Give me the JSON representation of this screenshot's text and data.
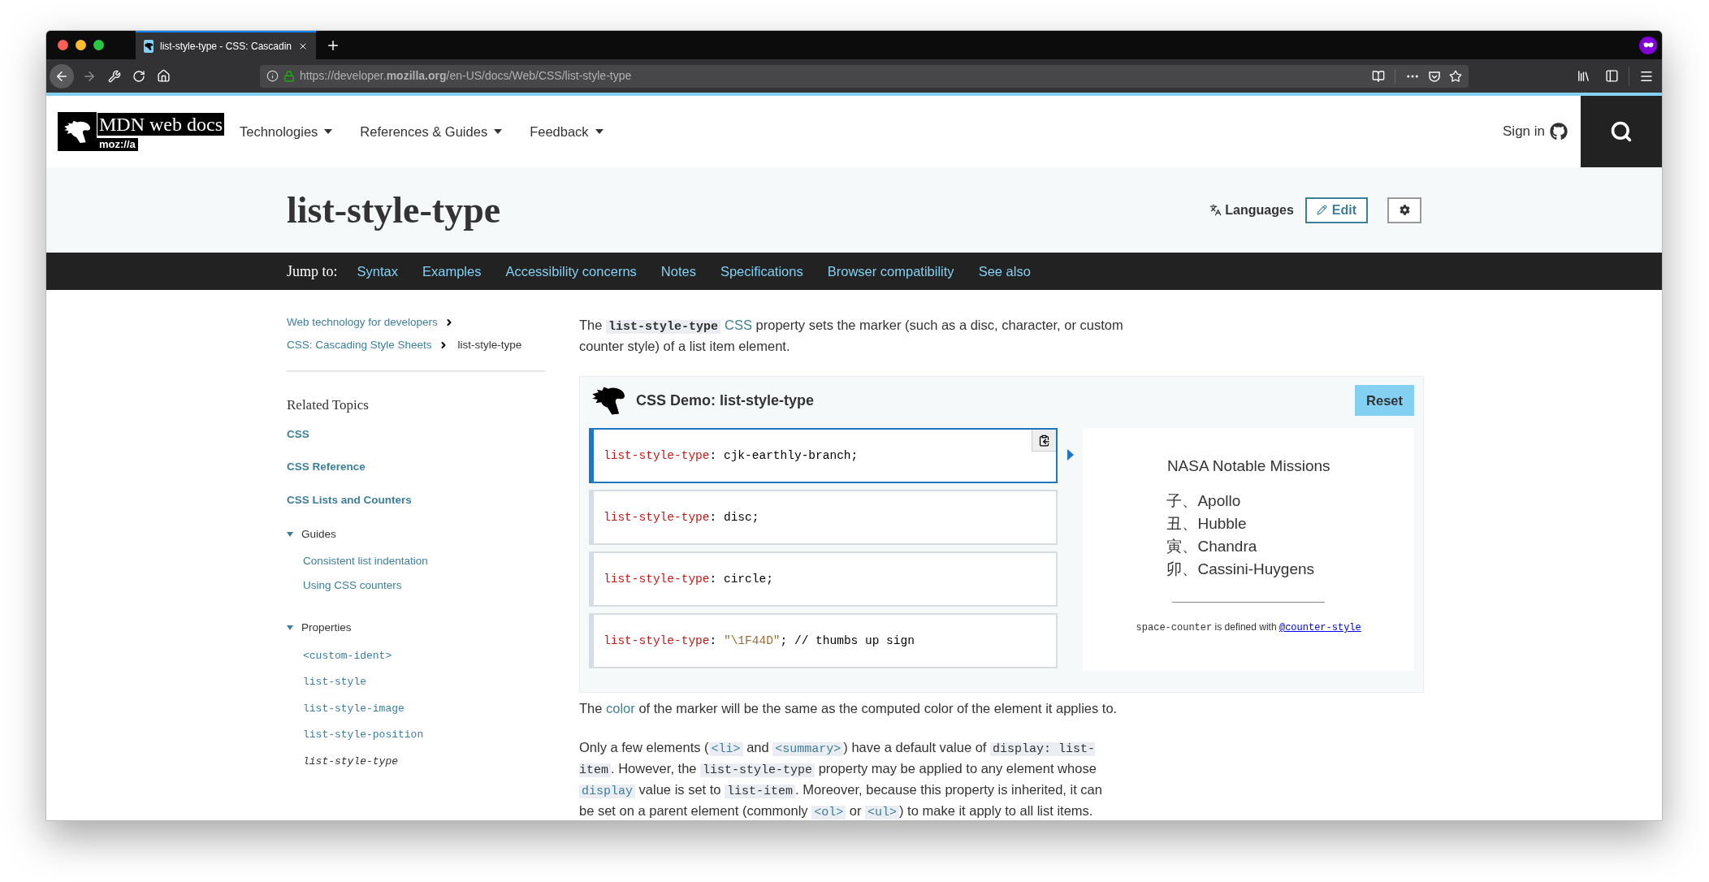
{
  "browser": {
    "tab": {
      "title": "list-style-type - CSS: Cascadin",
      "selected": true
    },
    "url": "https://developer.**mozilla.org**/en-US/docs/Web/CSS/list-style-type"
  },
  "header": {
    "logo_text": "MDN web docs",
    "logo_subtext": "moz://a",
    "nav": [
      {
        "label": "Technologies"
      },
      {
        "label": "References & Guides"
      },
      {
        "label": "Feedback"
      }
    ],
    "sign_in": "Sign in"
  },
  "title": "list-style-type",
  "languages": "Languages",
  "edit": "Edit",
  "jump": {
    "label": "Jump to:",
    "links": [
      "Syntax",
      "Examples",
      "Accessibility concerns",
      "Notes",
      "Specifications",
      "Browser compatibility",
      "See also"
    ]
  },
  "breadcrumb_rows": [
    [
      {
        "kind": "link",
        "label": "Web technology for developers"
      }
    ],
    [
      {
        "kind": "link",
        "label": "CSS: Cascading Style Sheets"
      },
      {
        "kind": "current",
        "label": "list-style-type"
      }
    ]
  ],
  "sidebar": {
    "heading": "Related Topics",
    "items": [
      {
        "kind": "link",
        "label": "CSS"
      },
      {
        "kind": "link",
        "label": "CSS Reference"
      },
      {
        "kind": "link",
        "label": "CSS Lists and Counters"
      },
      {
        "kind": "group",
        "label": "Guides",
        "expanded": true,
        "children": [
          {
            "label": "Consistent list indentation",
            "code": false,
            "selected": false
          },
          {
            "label": "Using CSS counters",
            "code": false,
            "selected": false
          }
        ]
      },
      {
        "kind": "group",
        "label": "Properties",
        "expanded": true,
        "children": [
          {
            "label": "<custom-ident>",
            "code": true,
            "selected": false
          },
          {
            "label": "list-style",
            "code": true,
            "selected": false
          },
          {
            "label": "list-style-image",
            "code": true,
            "selected": false
          },
          {
            "label": "list-style-position",
            "code": true,
            "selected": false
          },
          {
            "label": "list-style-type",
            "code": true,
            "selected": true
          }
        ]
      }
    ]
  },
  "intro": [
    {
      "kind": "text",
      "text": "The "
    },
    {
      "kind": "strong-code",
      "text": "list-style-type"
    },
    {
      "kind": "link",
      "text": "CSS"
    },
    {
      "kind": "text",
      "text": " property sets the marker (such as a disc, character, or custom counter style) of a list item element."
    }
  ],
  "demo": {
    "title": "CSS Demo: list-style-type",
    "reset": "Reset",
    "choices": [
      {
        "selected": true,
        "segments": [
          {
            "kind": "property",
            "text": "list-style-type"
          },
          {
            "kind": "plain",
            "text": ": cjk-earthly-branch;"
          }
        ]
      },
      {
        "selected": false,
        "segments": [
          {
            "kind": "property",
            "text": "list-style-type"
          },
          {
            "kind": "plain",
            "text": ": disc;"
          }
        ]
      },
      {
        "selected": false,
        "segments": [
          {
            "kind": "property",
            "text": "list-style-type"
          },
          {
            "kind": "plain",
            "text": ": circle;"
          }
        ]
      },
      {
        "selected": false,
        "segments": [
          {
            "kind": "property",
            "text": "list-style-type"
          },
          {
            "kind": "plain",
            "text": ": "
          },
          {
            "kind": "string",
            "text": "\"\\1F44D\""
          },
          {
            "kind": "plain",
            "text": "; // thumbs up sign"
          }
        ]
      }
    ],
    "output": {
      "heading": "NASA Notable Missions",
      "items": [
        {
          "marker": "子、",
          "label": "Apollo"
        },
        {
          "marker": "丑、",
          "label": "Hubble"
        },
        {
          "marker": "寅、",
          "label": "Chandra"
        },
        {
          "marker": "卯、",
          "label": "Cassini-Huygens"
        }
      ],
      "note": [
        {
          "kind": "code",
          "text": "space-counter"
        },
        {
          "kind": "text",
          "text": " is defined with "
        },
        {
          "kind": "underlined-link",
          "text": "@counter-style"
        }
      ]
    }
  },
  "paragraphs": [
    [
      {
        "kind": "text",
        "text": "The "
      },
      {
        "kind": "link",
        "text": "color"
      },
      {
        "kind": "text",
        "text": " of the marker will be the same as the computed color of the element it applies to."
      }
    ],
    [
      {
        "kind": "text",
        "text": "Only a few elements ("
      },
      {
        "kind": "code-link",
        "text": "<li>"
      },
      {
        "kind": "text",
        "text": " and "
      },
      {
        "kind": "code-link",
        "text": "<summary>"
      },
      {
        "kind": "text",
        "text": ") have a default value of "
      },
      {
        "kind": "code",
        "text": "display: list-item"
      },
      {
        "kind": "text",
        "text": ". However, the "
      },
      {
        "kind": "code",
        "text": "list-style-type"
      },
      {
        "kind": "text",
        "text": " property may be applied to any element whose "
      },
      {
        "kind": "code-link",
        "text": "display"
      },
      {
        "kind": "text",
        "text": " value is set to "
      },
      {
        "kind": "code",
        "text": "list-item"
      },
      {
        "kind": "text",
        "text": ". Moreover, because this property is inherited, it can be set on a parent element (commonly "
      },
      {
        "kind": "code-link",
        "text": "<ol>"
      },
      {
        "kind": "text",
        "text": " or "
      },
      {
        "kind": "code-link",
        "text": "<ul>"
      },
      {
        "kind": "text",
        "text": ") to make it apply to all list items."
      }
    ]
  ]
}
